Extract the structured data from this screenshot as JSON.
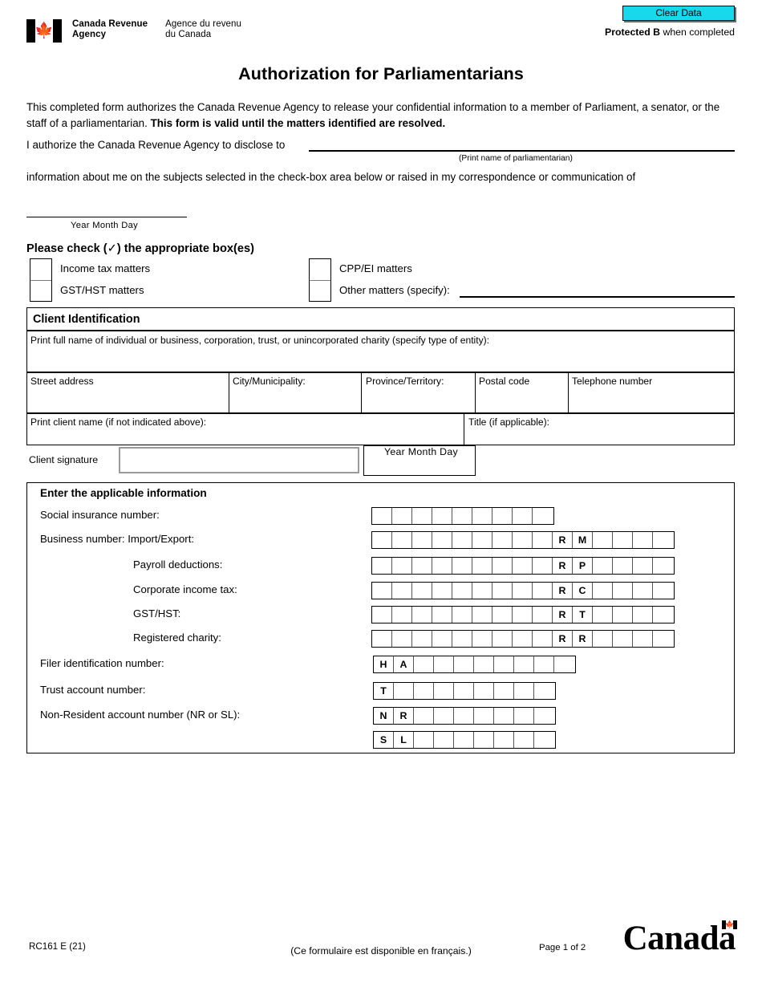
{
  "header": {
    "agency_en_line1": "Canada Revenue",
    "agency_en_line2": "Agency",
    "agency_fr_line1": "Agence du revenu",
    "agency_fr_line2": "du Canada",
    "flag_icon": "canada-flag-icon",
    "clear_data_label": "Clear Data",
    "clear_data_color": "#18d8ec",
    "protected_bold": "Protected B",
    "protected_rest": " when completed"
  },
  "title": "Authorization for Parliamentarians",
  "intro": {
    "text_part1": "This completed form authorizes the Canada Revenue Agency to release your confidential information to a member of Parliament, a senator, or the staff of a parliamentarian. ",
    "text_bold": "This form is valid until the matters identified are resolved.",
    "authorize_label": "I authorize the Canada Revenue Agency to disclose to",
    "parliamentarian_caption": "(Print name of parliamentarian)",
    "info_line": "information about me on the subjects selected in the check-box area below or raised in my correspondence or communication of",
    "date_caption": "Year  Month  Day"
  },
  "checkboxes": {
    "heading": "Please check (✓) the appropriate box(es)",
    "left": [
      {
        "label": "Income tax matters",
        "checked": false
      },
      {
        "label": "GST/HST matters",
        "checked": false
      }
    ],
    "right": [
      {
        "label": "CPP/EI matters",
        "checked": false
      },
      {
        "label": "Other matters (specify):",
        "checked": false
      }
    ],
    "other_value": ""
  },
  "client_identification": {
    "section_title": "Client Identification",
    "full_name_label": "Print full name of individual or business, corporation, trust, or unincorporated charity (specify type of entity):",
    "full_name_value": "",
    "fields": [
      {
        "label": "Street address",
        "value": ""
      },
      {
        "label": "City/Municipality:",
        "value": ""
      },
      {
        "label": "Province/Territory:",
        "value": ""
      },
      {
        "label": "Postal code",
        "value": ""
      },
      {
        "label": "Telephone number",
        "value": ""
      }
    ],
    "print_client_name_label": "Print client name (if not indicated above):",
    "print_client_name_value": "",
    "title_label": "Title (if applicable):",
    "title_value": "",
    "signature_label": "Client signature",
    "signature_value": "",
    "signature_date_caption": "Year  Month  Day",
    "signature_date_value": ""
  },
  "applicable_information": {
    "section_title": "Enter the applicable information",
    "rows": [
      {
        "label": "Social insurance number:",
        "indent": false,
        "prefix": [],
        "blanks_before": 9,
        "blanks_after": 0
      },
      {
        "label": "Business number: Import/Export:",
        "indent": false,
        "prefix": [
          "R",
          "M"
        ],
        "blanks_before": 9,
        "blanks_after": 4
      },
      {
        "label": "Payroll deductions:",
        "indent": true,
        "prefix": [
          "R",
          "P"
        ],
        "blanks_before": 9,
        "blanks_after": 4
      },
      {
        "label": "Corporate income tax:",
        "indent": true,
        "prefix": [
          "R",
          "C"
        ],
        "blanks_before": 9,
        "blanks_after": 4
      },
      {
        "label": "GST/HST:",
        "indent": true,
        "prefix": [
          "R",
          "T"
        ],
        "blanks_before": 9,
        "blanks_after": 4
      },
      {
        "label": "Registered charity:",
        "indent": true,
        "prefix": [
          "R",
          "R"
        ],
        "blanks_before": 9,
        "blanks_after": 4
      },
      {
        "label": "Filer identification number:",
        "indent": false,
        "prefix": [
          "H",
          "A"
        ],
        "blanks_before": 0,
        "blanks_after": 8
      },
      {
        "label": "Trust account number:",
        "indent": false,
        "prefix": [
          "T"
        ],
        "blanks_before": 0,
        "blanks_after": 8
      },
      {
        "label": "Non-Resident account number (NR or SL):",
        "indent": false,
        "prefix": [
          "N",
          "R"
        ],
        "blanks_before": 0,
        "blanks_after": 7
      },
      {
        "label": "",
        "indent": false,
        "prefix": [
          "S",
          "L"
        ],
        "blanks_before": 0,
        "blanks_after": 7
      }
    ]
  },
  "footer": {
    "form_code": "RC161 E (21)",
    "french_note": "(Ce formulaire est disponible en français.)",
    "page_number": "Page 1 of 2",
    "wordmark": "Canad",
    "wordmark_last": "a",
    "wordmark_flag_icon": "canada-wordmark-flag-icon"
  }
}
